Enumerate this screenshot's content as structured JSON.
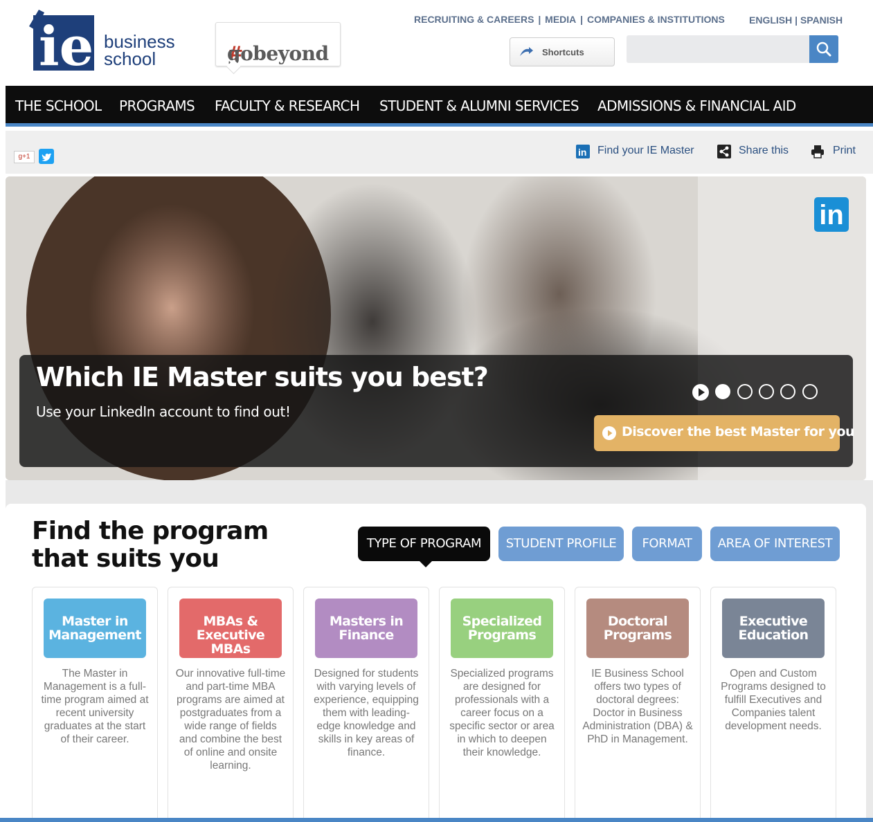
{
  "header": {
    "logo_text": [
      "business",
      "school"
    ],
    "gobeyond_hash": "#",
    "gobeyond_word": "gobeyond",
    "top_links": [
      "RECRUITING & CAREERS",
      "MEDIA",
      "COMPANIES & INSTITUTIONS"
    ],
    "languages": [
      "ENGLISH",
      "SPANISH"
    ],
    "shortcuts_label": "Shortcuts",
    "search_placeholder": ""
  },
  "nav": {
    "items": [
      "THE SCHOOL",
      "PROGRAMS",
      "FACULTY & RESEARCH",
      "STUDENT & ALUMNI SERVICES",
      "ADMISSIONS & FINANCIAL AID"
    ]
  },
  "utility": {
    "gplus_label": "g+1",
    "find_master": "Find your IE Master",
    "share": "Share this",
    "print": "Print"
  },
  "hero": {
    "title": "Which IE Master suits you best?",
    "subtitle": "Use your LinkedIn account to find out!",
    "cta": "Discover the best Master for you",
    "linkedin_badge": "in",
    "slide_count": 5,
    "active_slide": 1
  },
  "finder": {
    "title_line1": "Find the program",
    "title_line2": "that suits you",
    "filters": [
      "TYPE OF PROGRAM",
      "STUDENT PROFILE",
      "FORMAT",
      "AREA OF INTEREST"
    ],
    "active_filter": 0
  },
  "programs": [
    {
      "title": "Master in Management",
      "color": "#5bb3e0",
      "desc": "The Master in Management is a full-time program aimed at recent university graduates at the start of their career."
    },
    {
      "title": "MBAs & Executive MBAs",
      "color": "#e36a6a",
      "desc": "Our innovative full-time and part-time MBA programs are aimed at postgraduates from a wide range of fields and combine the best of online and onsite learning."
    },
    {
      "title": "Masters in Finance",
      "color": "#b28cc2",
      "desc": "Designed for students with varying levels of experience, equipping them with leading-edge knowledge and skills in key areas of finance."
    },
    {
      "title": "Specialized Programs",
      "color": "#98d07f",
      "desc": "Specialized programs are designed for professionals with a career focus on a specific sector or area in which to deepen their knowledge."
    },
    {
      "title": "Doctoral Programs",
      "color": "#b58b7f",
      "desc": "IE Business School offers two types of doctoral degrees: Doctor in Business Administration (DBA) & PhD in Management."
    },
    {
      "title": "Executive Education",
      "color": "#7a8596",
      "desc": "Open and Custom Programs designed to fulfill Executives and Companies talent development needs."
    }
  ],
  "colors": {
    "nav_bg": "#0d0d0d",
    "accent_blue": "#4a86c5",
    "filter_blue": "#6f9dd3",
    "cta_gold": "#e3b366",
    "brand_navy": "#1e3f7a"
  }
}
